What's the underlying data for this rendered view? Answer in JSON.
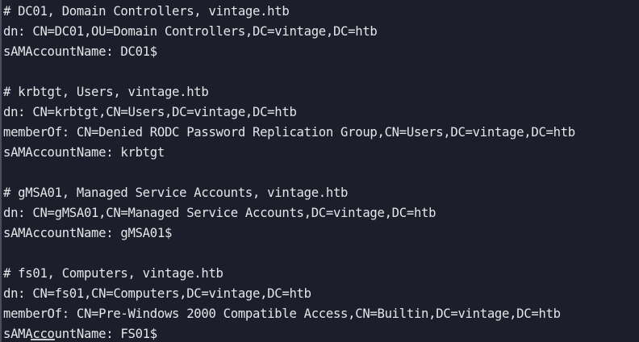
{
  "terminal": {
    "entries": [
      {
        "header": "# DC01, Domain Controllers, vintage.htb",
        "dn": "dn: CN=DC01,OU=Domain Controllers,DC=vintage,DC=htb",
        "sam": "sAMAccountName: DC01$"
      },
      {
        "header": "# krbtgt, Users, vintage.htb",
        "dn": "dn: CN=krbtgt,CN=Users,DC=vintage,DC=htb",
        "memberof": "memberOf: CN=Denied RODC Password Replication Group,CN=Users,DC=vintage,DC=htb",
        "sam": "sAMAccountName: krbtgt"
      },
      {
        "header": "# gMSA01, Managed Service Accounts, vintage.htb",
        "dn": "dn: CN=gMSA01,CN=Managed Service Accounts,DC=vintage,DC=htb",
        "sam": "sAMAccountName: gMSA01$"
      },
      {
        "header": "# fs01, Computers, vintage.htb",
        "dn": "dn: CN=fs01,CN=Computers,DC=vintage,DC=htb",
        "memberof": "memberOf: CN=Pre-Windows 2000 Compatible Access,CN=Builtin,DC=vintage,DC=htb",
        "sam": "sAMAccountName: FS01$"
      }
    ]
  }
}
